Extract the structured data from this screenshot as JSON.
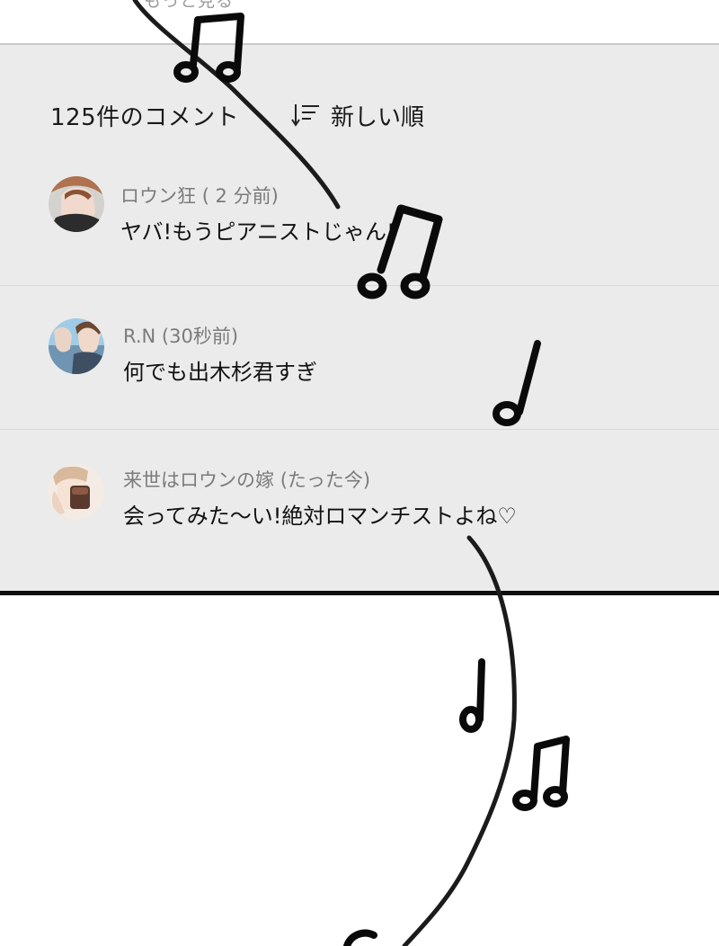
{
  "top": {
    "partial_link": "もっと見る"
  },
  "comments_header": {
    "count_label": "125件のコメント",
    "sort_label": "新しい順"
  },
  "comments": [
    {
      "user": "ロウン狂",
      "time": "( 2 分前)",
      "text": "ヤバ!もうピアニストじゃん!"
    },
    {
      "user": "R.N",
      "time": "(30秒前)",
      "text": "何でも出木杉君すぎ"
    },
    {
      "user": "来世はロウンの嫁",
      "time": "(たった今)",
      "text": "会ってみた～い!絶対ロマンチストよね♡"
    }
  ],
  "colors": {
    "panel_bg": "#ebebeb",
    "meta_text": "#7b7b7b",
    "body_text": "#111111"
  },
  "icons": [
    "sort-icon",
    "avatar",
    "music-note-icon"
  ]
}
